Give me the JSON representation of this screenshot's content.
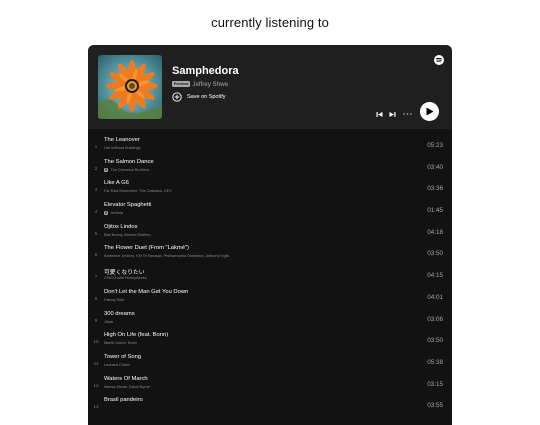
{
  "heading": "currently listening to",
  "player": {
    "track_title": "Samphedora",
    "preview_badge": "Preview",
    "artist": "Jeffrey Shwe",
    "save_label": "Save on Spotify",
    "icons": {
      "logo": "spotify-logo-icon",
      "save": "plus-circle-icon",
      "previous": "skip-previous-icon",
      "next": "skip-next-icon",
      "more": "more-dots-icon",
      "play": "play-icon"
    }
  },
  "tracks": [
    {
      "num": "1",
      "title": "The Leanover",
      "artist": "Life Without Buildings",
      "duration": "05:23",
      "explicit": false
    },
    {
      "num": "2",
      "title": "The Salmon Dance",
      "artist": "The Chemical Brothers",
      "duration": "03:40",
      "explicit": true
    },
    {
      "num": "3",
      "title": "Like A G6",
      "artist": "Far East Movement, The Cataracs, DEV",
      "duration": "03:36",
      "explicit": false
    },
    {
      "num": "4",
      "title": "Elevator Spaghetti",
      "artist": "Jin3wia",
      "duration": "01:45",
      "explicit": true
    },
    {
      "num": "5",
      "title": "Ojitos Lindos",
      "artist": "Bad Bunny, Bomba Estéreo",
      "duration": "04:18",
      "explicit": false
    },
    {
      "num": "6",
      "title": "The Flower Duet (From \"Lakmé\")",
      "artist": "Katherine Jenkins, Kiri Te Kanawa, Philharmonia Orchestra, Anthony Inglis",
      "duration": "03:50",
      "explicit": false
    },
    {
      "num": "7",
      "title": "可愛くなりたい",
      "artist": "CHiCO with HoneyWorks",
      "duration": "04:15",
      "explicit": false
    },
    {
      "num": "8",
      "title": "Don't Let the Man Get You Down",
      "artist": "Fatboy Slim",
      "duration": "04:01",
      "explicit": false
    },
    {
      "num": "9",
      "title": "300 dreams",
      "artist": "Jiban",
      "duration": "03:06",
      "explicit": false
    },
    {
      "num": "10",
      "title": "High On Life (feat. Bonn)",
      "artist": "Martin Garrix, Bonn",
      "duration": "03:50",
      "explicit": false
    },
    {
      "num": "11",
      "title": "Tower of Song",
      "artist": "Leonard Cohen",
      "duration": "05:38",
      "explicit": false
    },
    {
      "num": "12",
      "title": "Waters Of March",
      "artist": "Marisa Monte, David Byrne",
      "duration": "03:15",
      "explicit": false
    },
    {
      "num": "13",
      "title": "Brasil pandeiro",
      "artist": "",
      "duration": "03:55",
      "explicit": false
    }
  ],
  "explicit_badge": "E",
  "colors": {
    "background": "#121212",
    "header": "#1f1f1f",
    "text_primary": "#ffffff",
    "text_secondary": "#a7a7a7"
  }
}
